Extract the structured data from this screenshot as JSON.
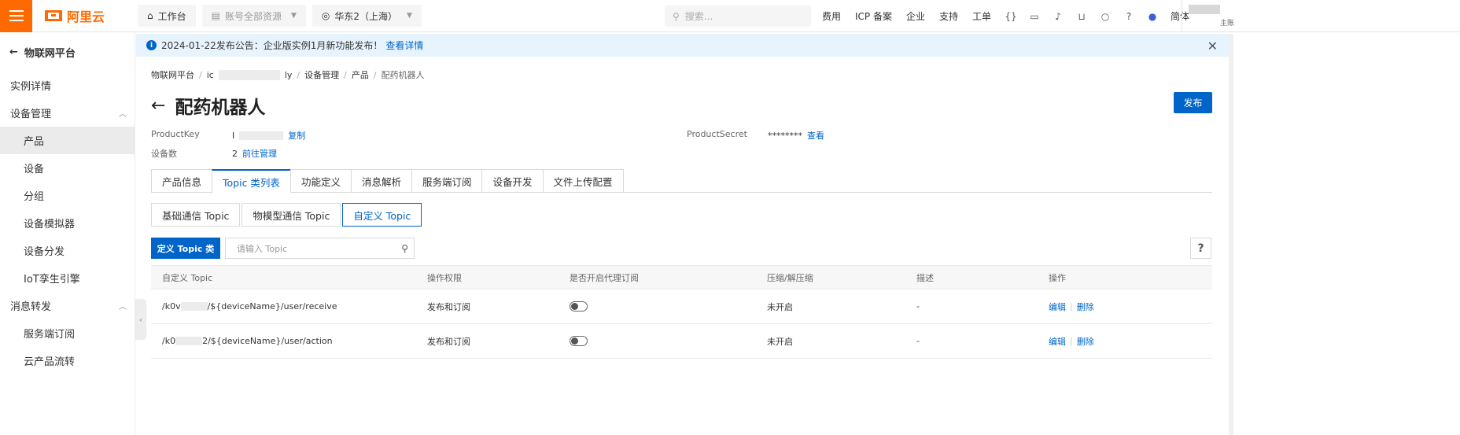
{
  "topbar": {
    "logo_text": "阿里云",
    "workbench": "工作台",
    "account_resources": "账号全部资源",
    "region": "华东2（上海）",
    "search_placeholder": "搜索...",
    "links": [
      "费用",
      "ICP 备案",
      "企业",
      "支持",
      "工单"
    ],
    "lang": "简体",
    "user_sub": "主账"
  },
  "sidebar": {
    "back_label": "物联网平台",
    "items": [
      {
        "type": "item",
        "label": "实例详情"
      },
      {
        "type": "group",
        "label": "设备管理"
      },
      {
        "type": "sub",
        "label": "产品",
        "active": true
      },
      {
        "type": "sub",
        "label": "设备"
      },
      {
        "type": "sub",
        "label": "分组"
      },
      {
        "type": "sub",
        "label": "设备模拟器"
      },
      {
        "type": "sub",
        "label": "设备分发"
      },
      {
        "type": "sub",
        "label": "IoT孪生引擎"
      },
      {
        "type": "group",
        "label": "消息转发"
      },
      {
        "type": "sub",
        "label": "服务端订阅"
      },
      {
        "type": "sub",
        "label": "云产品流转"
      }
    ]
  },
  "notice": {
    "text": "2024-01-22发布公告：企业版实例1月新功能发布！",
    "link": "查看详情"
  },
  "breadcrumb": {
    "items": [
      "物联网平台",
      "ic",
      "ly",
      "设备管理",
      "产品",
      "配药机器人"
    ]
  },
  "page": {
    "title": "配药机器人",
    "publish": "发布",
    "product_key_label": "ProductKey",
    "product_key_prefix": "I",
    "copy": "复制",
    "product_secret_label": "ProductSecret",
    "product_secret_value": "********",
    "view": "查看",
    "device_count_label": "设备数",
    "device_count": "2",
    "manage_link": "前往管理"
  },
  "tabs": [
    "产品信息",
    "Topic 类列表",
    "功能定义",
    "消息解析",
    "服务端订阅",
    "设备开发",
    "文件上传配置"
  ],
  "segments": [
    "基础通信 Topic",
    "物模型通信 Topic",
    "自定义 Topic"
  ],
  "toolbar": {
    "define_btn": "定义 Topic 类",
    "search_placeholder": "请输入 Topic",
    "help": "?"
  },
  "table": {
    "headers": [
      "自定义 Topic",
      "操作权限",
      "是否开启代理订阅",
      "压缩/解压缩",
      "描述",
      "操作"
    ],
    "rows": [
      {
        "topic_prefix": "/k0v",
        "topic_suffix": "/${deviceName}/user/receive",
        "permission": "发布和订阅",
        "compress": "未开启",
        "desc": "-",
        "edit": "编辑",
        "delete": "删除"
      },
      {
        "topic_prefix": "/k0",
        "topic_suffix": "2/${deviceName}/user/action",
        "permission": "发布和订阅",
        "compress": "未开启",
        "desc": "-",
        "edit": "编辑",
        "delete": "删除"
      }
    ]
  }
}
